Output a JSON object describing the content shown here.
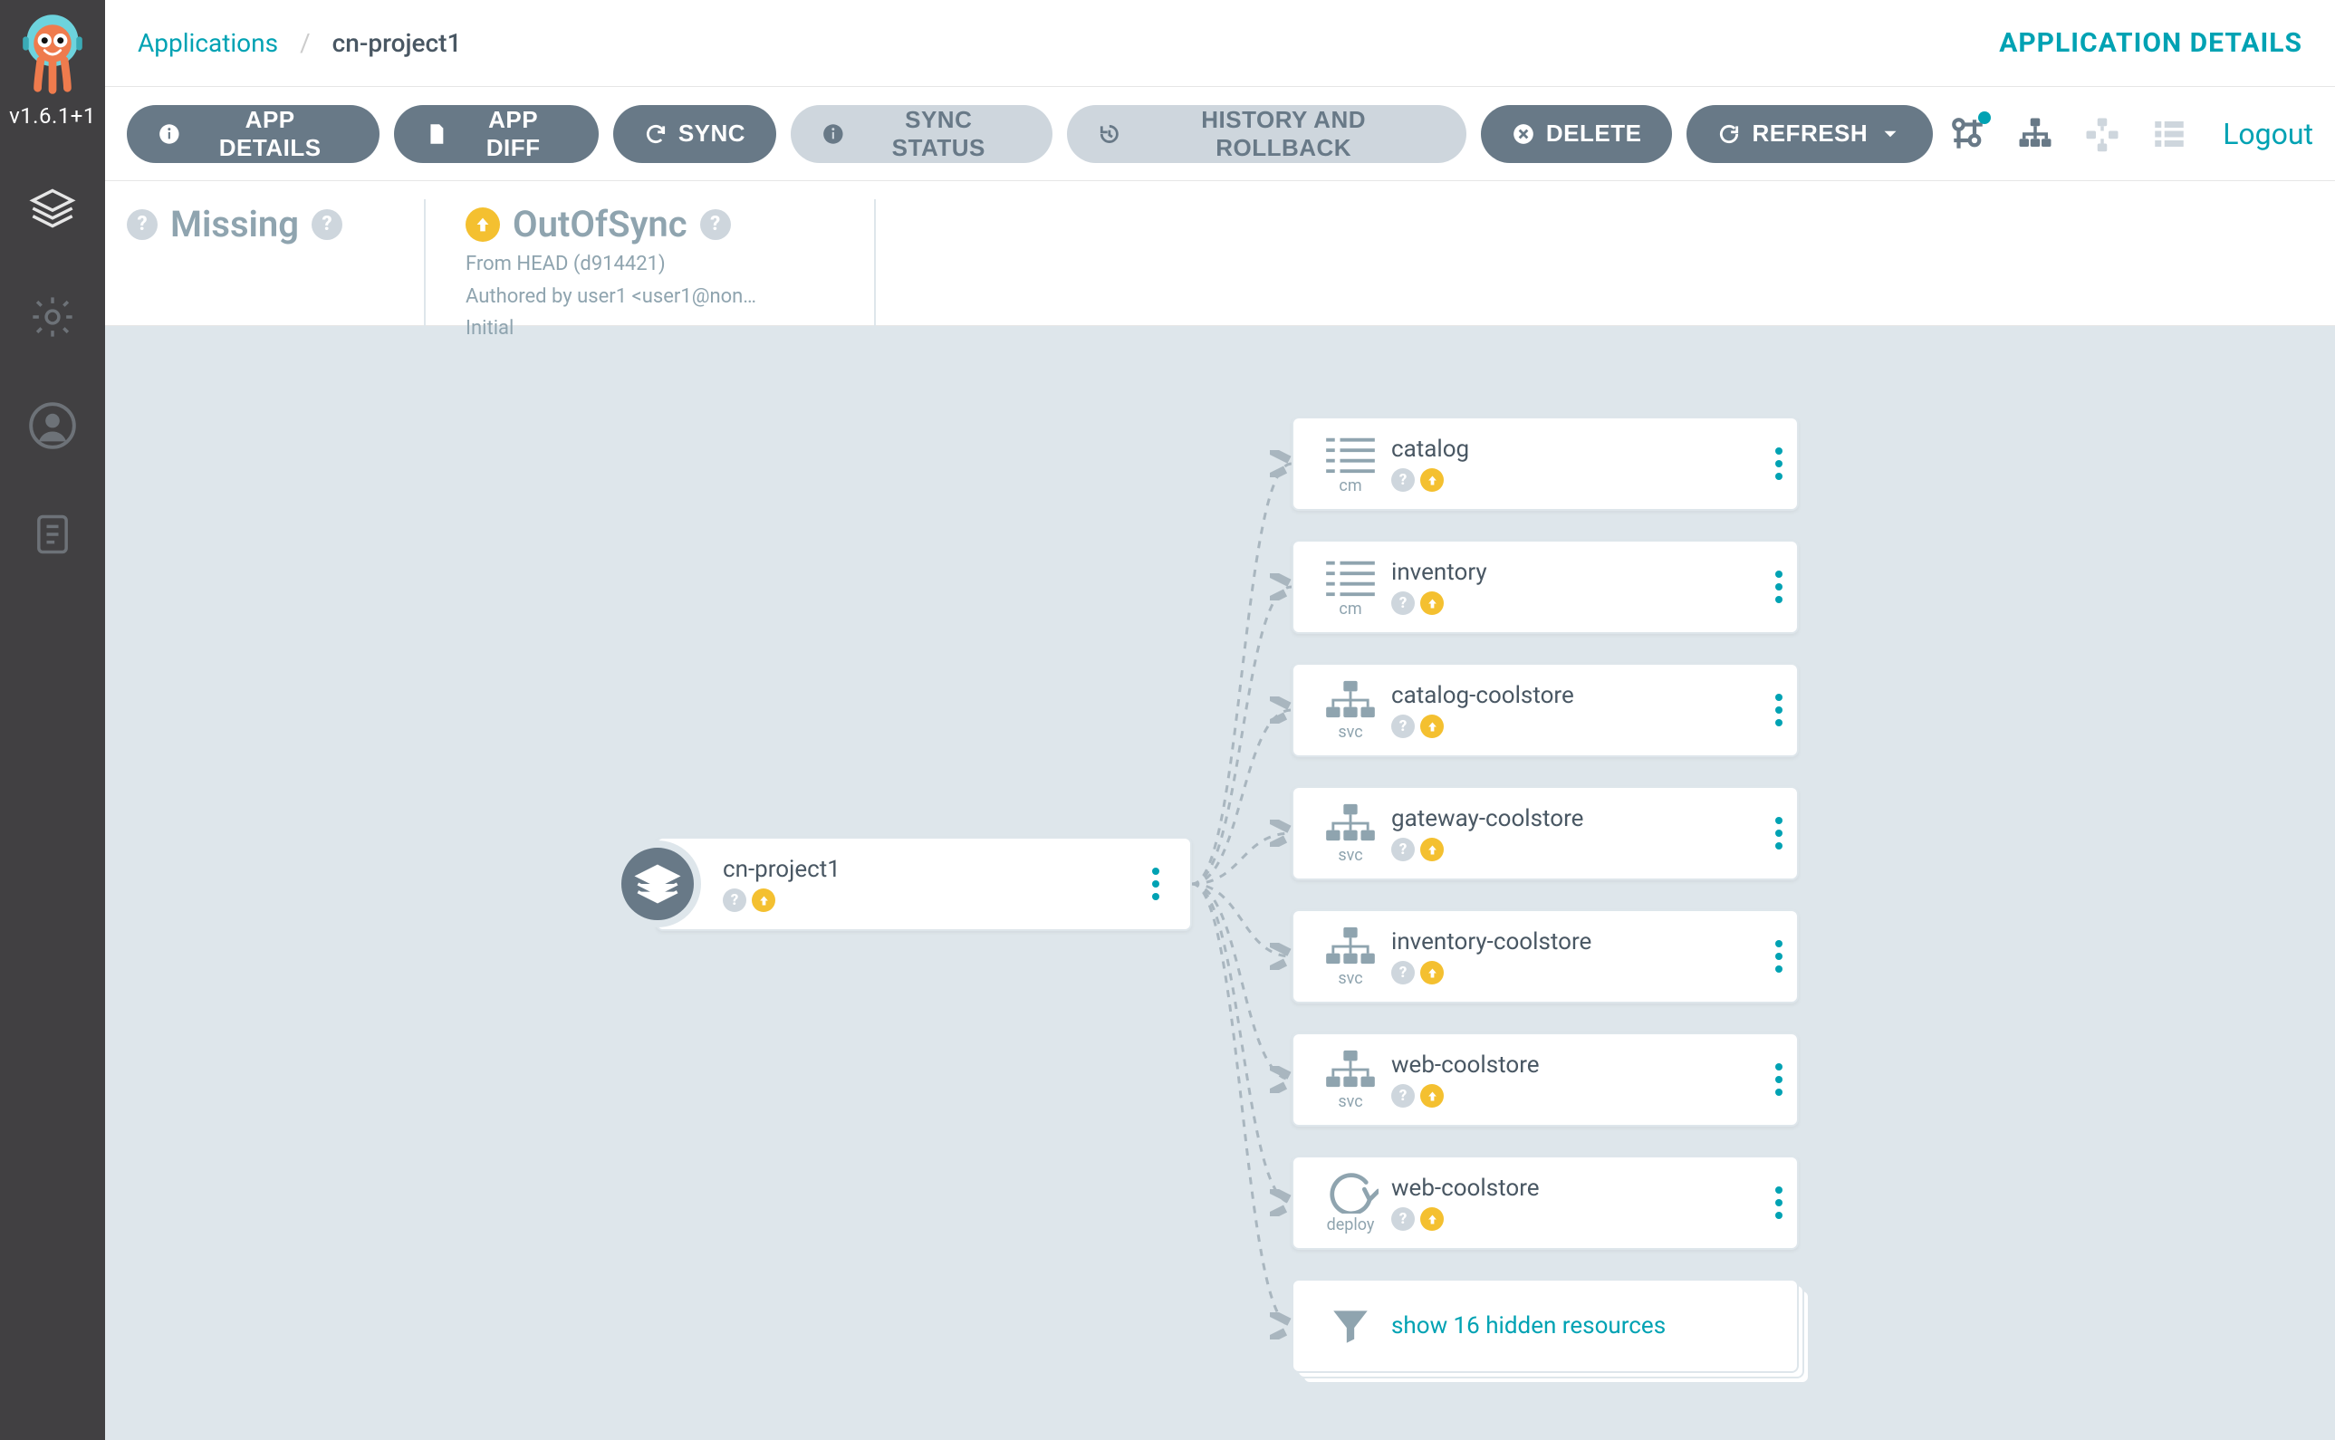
{
  "sidebar": {
    "version": "v1.6.1+1"
  },
  "header": {
    "breadcrumb_root": "Applications",
    "breadcrumb_current": "cn-project1",
    "page_title": "APPLICATION DETAILS"
  },
  "toolbar": {
    "app_details": "APP DETAILS",
    "app_diff": "APP DIFF",
    "sync": "SYNC",
    "sync_status": "SYNC STATUS",
    "history": "HISTORY AND ROLLBACK",
    "delete": "DELETE",
    "refresh": "REFRESH",
    "logout": "Logout"
  },
  "status": {
    "health_label": "Missing",
    "sync_label": "OutOfSync",
    "sync_meta1": "From HEAD (d914421)",
    "sync_meta2": "Authored by user1 <user1@non…",
    "sync_meta3": "Initial"
  },
  "tree": {
    "root": {
      "name": "cn-project1"
    },
    "children": [
      {
        "name": "catalog",
        "kind": "cm"
      },
      {
        "name": "inventory",
        "kind": "cm"
      },
      {
        "name": "catalog-coolstore",
        "kind": "svc"
      },
      {
        "name": "gateway-coolstore",
        "kind": "svc"
      },
      {
        "name": "inventory-coolstore",
        "kind": "svc"
      },
      {
        "name": "web-coolstore",
        "kind": "svc"
      },
      {
        "name": "web-coolstore",
        "kind": "deploy"
      }
    ],
    "more_link": "show 16 hidden resources"
  }
}
